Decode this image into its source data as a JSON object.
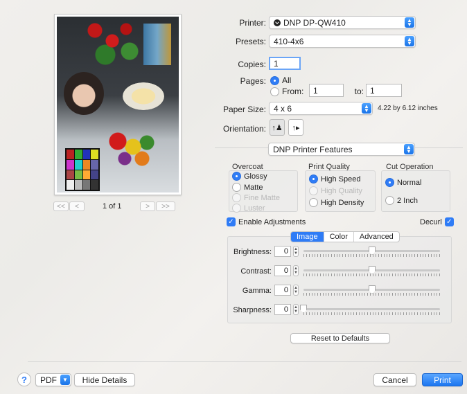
{
  "preview": {
    "page_count": "1 of 1",
    "first_label": "<<",
    "prev_label": "<",
    "next_label": ">",
    "last_label": ">>"
  },
  "printer": {
    "label": "Printer:",
    "value": "DNP DP-QW410"
  },
  "presets": {
    "label": "Presets:",
    "value": "410-4x6"
  },
  "copies": {
    "label": "Copies:",
    "value": "1"
  },
  "pages": {
    "label": "Pages:",
    "all_label": "All",
    "from_label": "From:",
    "from_value": "1",
    "to_label": "to:",
    "to_value": "1"
  },
  "paper_size": {
    "label": "Paper Size:",
    "value": "4 x 6",
    "dimensions": "4.22 by 6.12 inches"
  },
  "orientation": {
    "label": "Orientation:"
  },
  "features_menu": {
    "value": "DNP Printer Features"
  },
  "overcoat": {
    "title": "Overcoat",
    "options": [
      "Glossy",
      "Matte",
      "Fine Matte",
      "Luster"
    ]
  },
  "print_quality": {
    "title": "Print Quality",
    "options": [
      "High Speed",
      "High Quality",
      "High Density"
    ]
  },
  "cut_operation": {
    "title": "Cut Operation",
    "options": [
      "Normal",
      "2 Inch"
    ]
  },
  "enable_adjustments": {
    "label": "Enable Adjustments",
    "checked": true
  },
  "decurl": {
    "label": "Decurl",
    "checked": true
  },
  "tabs": [
    "Image",
    "Color",
    "Advanced"
  ],
  "sliders": [
    {
      "label": "Brightness:",
      "value": "0",
      "level": 0.5
    },
    {
      "label": "Contrast:",
      "value": "0",
      "level": 0.5
    },
    {
      "label": "Gamma:",
      "value": "0",
      "level": 0.5
    },
    {
      "label": "Sharpness:",
      "value": "0",
      "level": 0.0
    }
  ],
  "reset_button": "Reset to Defaults",
  "footer": {
    "help_label": "?",
    "pdf_label": "PDF",
    "hide_details_label": "Hide Details",
    "cancel_label": "Cancel",
    "print_label": "Print"
  },
  "colors": {
    "accent": "#2f7cf6"
  }
}
